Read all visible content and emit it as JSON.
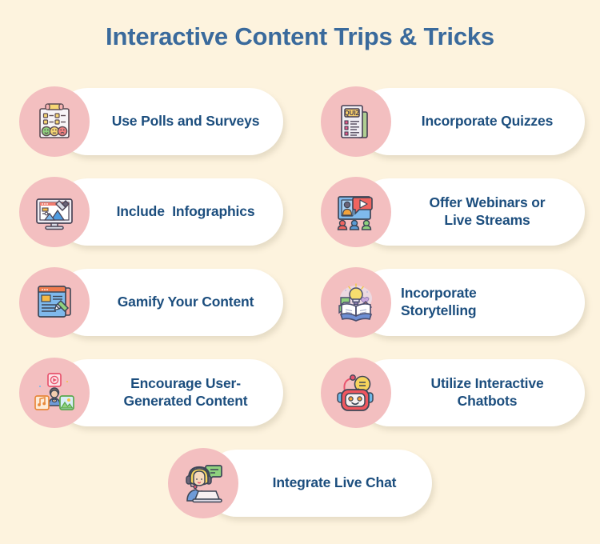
{
  "page": {
    "background_color": "#FDF3DE",
    "title": "Interactive Content Trips & Tricks",
    "title_color": "#3A6A9C",
    "card_text_color": "#1C4E7E",
    "badge_color": "#F3BFC0",
    "pill_color": "#FFFFFF"
  },
  "cards": [
    {
      "label": "Use Polls and Surveys",
      "icon": "poll-survey-clipboard-icon",
      "column": "left",
      "row": 1
    },
    {
      "label": "Incorporate Quizzes",
      "icon": "quiz-paper-icon",
      "column": "right",
      "row": 1
    },
    {
      "label": "Include  Infographics",
      "icon": "infographic-monitor-icon",
      "column": "left",
      "row": 2
    },
    {
      "label": "Offer Webinars or\nLive Streams",
      "icon": "webinar-live-stream-icon",
      "column": "right",
      "row": 2
    },
    {
      "label": "Gamify Your Content",
      "icon": "gamify-blog-pencil-icon",
      "column": "left",
      "row": 3
    },
    {
      "label": "Incorporate\nStorytelling",
      "icon": "storytelling-book-bulb-icon",
      "column": "right",
      "row": 3
    },
    {
      "label": "Encourage User-\nGenerated Content",
      "icon": "user-generated-content-icon",
      "column": "left",
      "row": 4
    },
    {
      "label": "Utilize Interactive\nChatbots",
      "icon": "chatbot-robot-icon",
      "column": "right",
      "row": 4
    },
    {
      "label": "Integrate Live Chat",
      "icon": "live-chat-agent-icon",
      "column": "center",
      "row": 5
    }
  ]
}
